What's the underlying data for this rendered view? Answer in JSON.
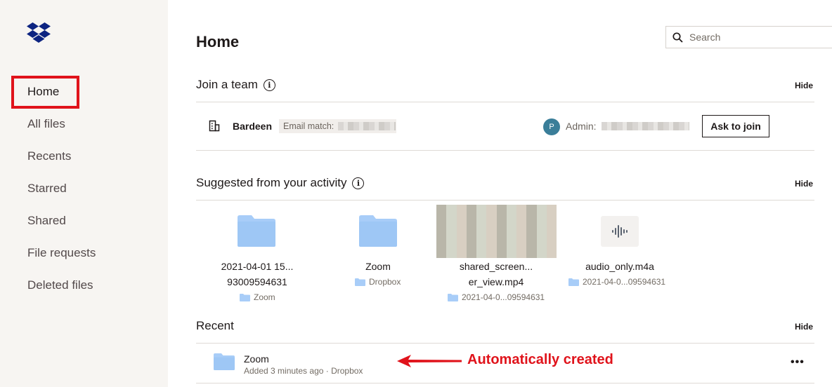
{
  "sidebar": {
    "logo": "dropbox-logo",
    "items": [
      {
        "label": "Home",
        "active": true
      },
      {
        "label": "All files"
      },
      {
        "label": "Recents"
      },
      {
        "label": "Starred"
      },
      {
        "label": "Shared"
      },
      {
        "label": "File requests"
      },
      {
        "label": "Deleted files"
      }
    ]
  },
  "header": {
    "title": "Home",
    "search_placeholder": "Search"
  },
  "join_team": {
    "title": "Join a team",
    "hide_label": "Hide",
    "team_name": "Bardeen",
    "email_match_label": "Email match:",
    "admin_label": "Admin:",
    "avatar_initial": "P",
    "ask_button": "Ask to join"
  },
  "suggested": {
    "title": "Suggested from your activity",
    "hide_label": "Hide",
    "items": [
      {
        "name_line1": "2021-04-01 15...",
        "name_line2": "93009594631",
        "location": "Zoom",
        "icon": "folder-icon"
      },
      {
        "name_line1": "Zoom",
        "location": "Dropbox",
        "icon": "folder-icon"
      },
      {
        "name_line1": "shared_screen...",
        "name_line2": "er_view.mp4",
        "location": "2021-04-0...09594631",
        "icon": "video-thumbnail"
      },
      {
        "name_line1": "audio_only.m4a",
        "location": "2021-04-0...09594631",
        "icon": "audio-icon"
      }
    ]
  },
  "recent": {
    "title": "Recent",
    "hide_label": "Hide",
    "items": [
      {
        "name": "Zoom",
        "meta": "Added 3 minutes ago · Dropbox",
        "icon": "folder-icon"
      }
    ]
  },
  "annotation": {
    "text": "Automatically created",
    "color": "#e0131b"
  },
  "colors": {
    "sidebar_bg": "#f7f5f2",
    "folder": "#a8cdf8",
    "dropbox_blue": "#0d2481",
    "avatar": "#3a7e99"
  }
}
